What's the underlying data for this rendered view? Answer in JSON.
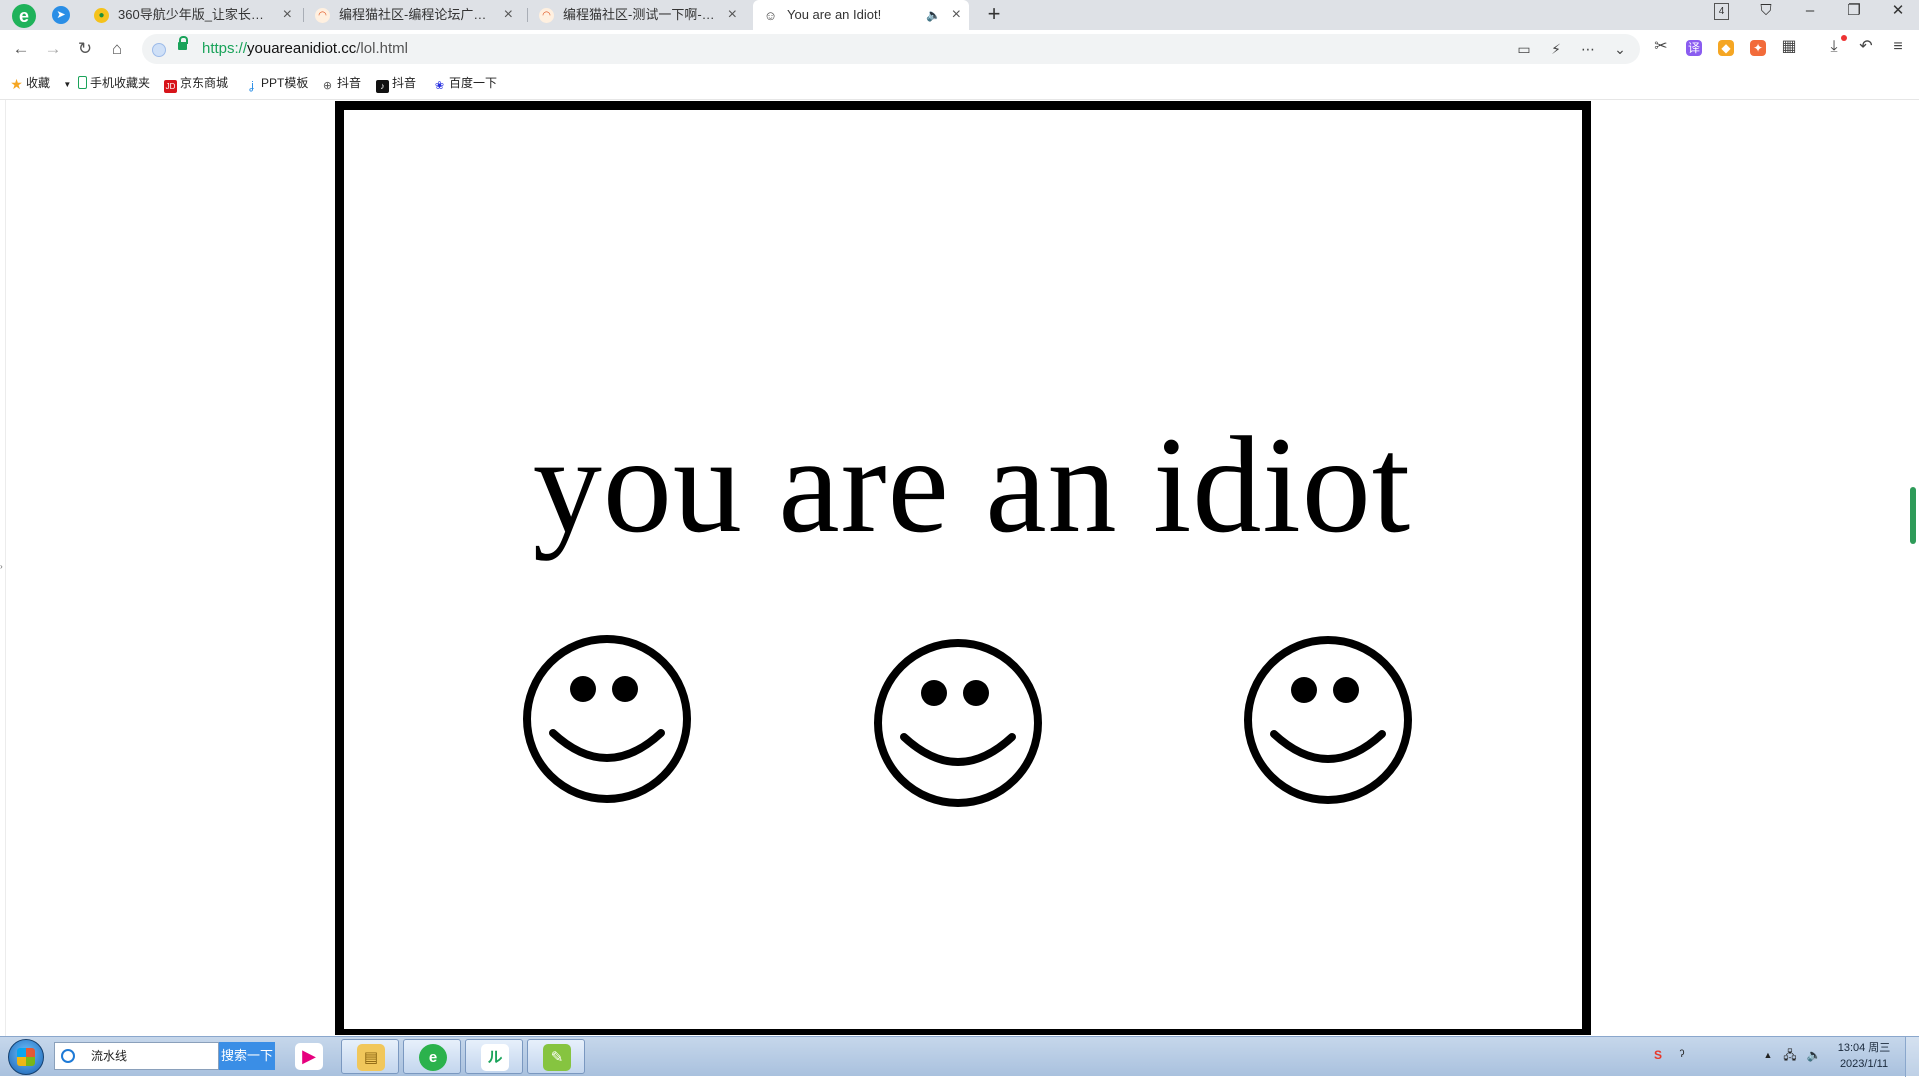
{
  "browser": {
    "tabs": [
      {
        "title": "360导航少年版_让家长放心，",
        "favicon": "nav-globe-icon",
        "active": false
      },
      {
        "title": "编程猫社区-编程论坛广场-编程",
        "favicon": "codemao-icon",
        "active": false
      },
      {
        "title": "编程猫社区-测试一下啊-编程猫",
        "favicon": "codemao-icon",
        "active": false
      },
      {
        "title": "You are an Idiot!",
        "favicon": "smiley-icon",
        "active": true,
        "audio": true
      }
    ],
    "tab_count": "4",
    "address": {
      "scheme": "https://",
      "host": "youareanidiot.cc",
      "path": "/lol.html"
    },
    "bookmarks": [
      {
        "label": "收藏",
        "icon": "star-icon",
        "has_dropdown": true
      },
      {
        "label": "手机收藏夹",
        "icon": "phone-icon"
      },
      {
        "label": "京东商城",
        "icon": "jd-icon"
      },
      {
        "label": "PPT模板",
        "icon": "ppt-icon"
      },
      {
        "label": "抖音",
        "icon": "globe-icon"
      },
      {
        "label": "抖音",
        "icon": "tiktok-icon"
      },
      {
        "label": "百度一下",
        "icon": "baidu-paw-icon"
      }
    ]
  },
  "page": {
    "headline": "you are an idiot",
    "smiley_count": 3,
    "border_color": "#000000",
    "background": "#ffffff"
  },
  "taskbar": {
    "search_text": "流水线",
    "search_button": "搜索一下",
    "apps": [
      "youku-icon",
      "file-explorer-icon",
      "browser-360-icon",
      "app-green-icon",
      "notepad-icon"
    ],
    "clock_time": "13:04 周三",
    "clock_date": "2023/1/11"
  },
  "colors": {
    "accent_green": "#1aa35a",
    "tab_strip": "#dee1e6",
    "scroll_thumb": "#2e9b59"
  }
}
